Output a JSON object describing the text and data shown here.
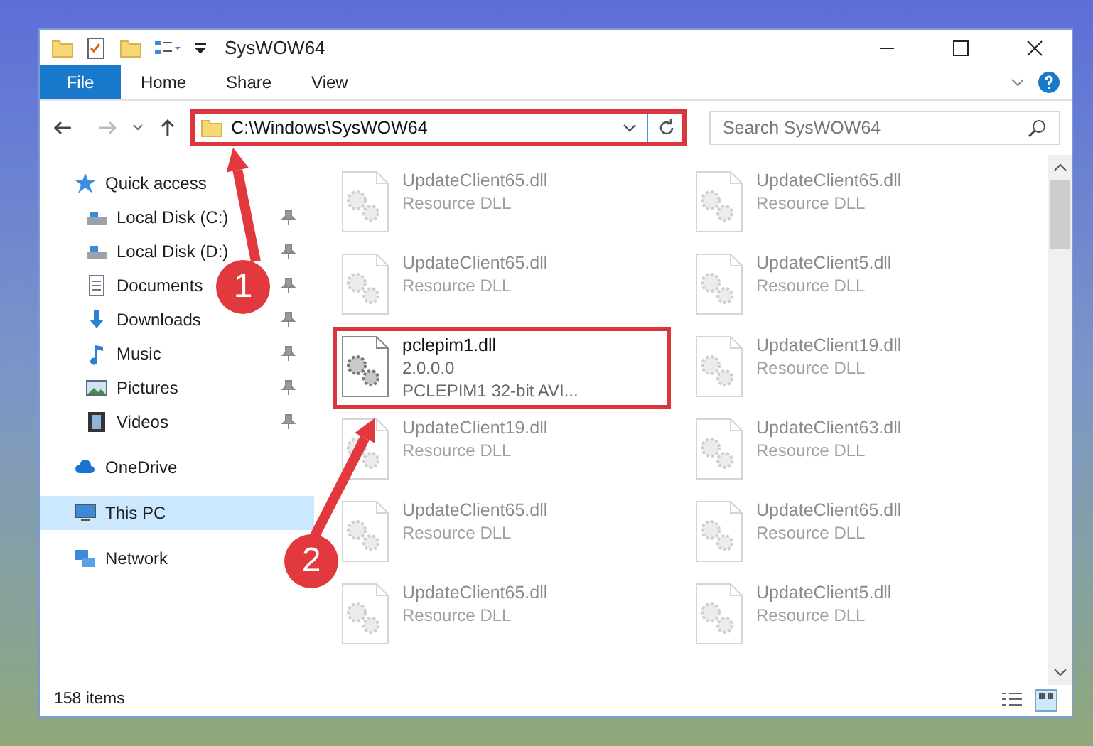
{
  "window": {
    "title": "SysWOW64"
  },
  "ribbon_tabs": [
    {
      "label": "File",
      "selected": true
    },
    {
      "label": "Home",
      "selected": false
    },
    {
      "label": "Share",
      "selected": false
    },
    {
      "label": "View",
      "selected": false
    }
  ],
  "address_bar": {
    "path": "C:\\Windows\\SysWOW64",
    "highlighted": true
  },
  "search": {
    "placeholder": "Search SysWOW64"
  },
  "sidebar": {
    "items": [
      {
        "label": "Quick access",
        "kind": "star",
        "selected": false,
        "children": [
          {
            "label": "Local Disk (C:)",
            "kind": "drive",
            "pinned": true,
            "selected": false
          },
          {
            "label": "Local Disk (D:)",
            "kind": "drive",
            "pinned": true,
            "selected": false
          },
          {
            "label": "Documents",
            "kind": "documents",
            "pinned": true,
            "selected": false
          },
          {
            "label": "Downloads",
            "kind": "downloads",
            "pinned": true,
            "selected": false
          },
          {
            "label": "Music",
            "kind": "music",
            "pinned": true,
            "selected": false
          },
          {
            "label": "Pictures",
            "kind": "pictures",
            "pinned": true,
            "selected": false
          },
          {
            "label": "Videos",
            "kind": "videos",
            "pinned": true,
            "selected": false
          }
        ]
      },
      {
        "label": "OneDrive",
        "kind": "cloud",
        "selected": false
      },
      {
        "label": "This PC",
        "kind": "pc",
        "selected": true
      },
      {
        "label": "Network",
        "kind": "network",
        "selected": false
      }
    ]
  },
  "files": [
    {
      "name": "UpdateClient65.dll",
      "lines": [
        "Resource DLL"
      ],
      "dimmed": true,
      "highlighted": false
    },
    {
      "name": "UpdateClient65.dll",
      "lines": [
        "Resource DLL"
      ],
      "dimmed": true,
      "highlighted": false
    },
    {
      "name": "UpdateClient65.dll",
      "lines": [
        "Resource DLL"
      ],
      "dimmed": true,
      "highlighted": false
    },
    {
      "name": "UpdateClient5.dll",
      "lines": [
        "Resource DLL"
      ],
      "dimmed": true,
      "highlighted": false
    },
    {
      "name": "pclepim1.dll",
      "lines": [
        "2.0.0.0",
        "PCLEPIM1 32-bit AVI..."
      ],
      "dimmed": false,
      "highlighted": true
    },
    {
      "name": "UpdateClient19.dll",
      "lines": [
        "Resource DLL"
      ],
      "dimmed": true,
      "highlighted": false
    },
    {
      "name": "UpdateClient19.dll",
      "lines": [
        "Resource DLL"
      ],
      "dimmed": true,
      "highlighted": false
    },
    {
      "name": "UpdateClient63.dll",
      "lines": [
        "Resource DLL"
      ],
      "dimmed": true,
      "highlighted": false
    },
    {
      "name": "UpdateClient65.dll",
      "lines": [
        "Resource DLL"
      ],
      "dimmed": true,
      "highlighted": false
    },
    {
      "name": "UpdateClient65.dll",
      "lines": [
        "Resource DLL"
      ],
      "dimmed": true,
      "highlighted": false
    },
    {
      "name": "UpdateClient65.dll",
      "lines": [
        "Resource DLL"
      ],
      "dimmed": true,
      "highlighted": false
    },
    {
      "name": "UpdateClient5.dll",
      "lines": [
        "Resource DLL"
      ],
      "dimmed": true,
      "highlighted": false
    }
  ],
  "annotations": [
    {
      "label": "1"
    },
    {
      "label": "2"
    }
  ],
  "status_bar": {
    "count": "158 items"
  }
}
